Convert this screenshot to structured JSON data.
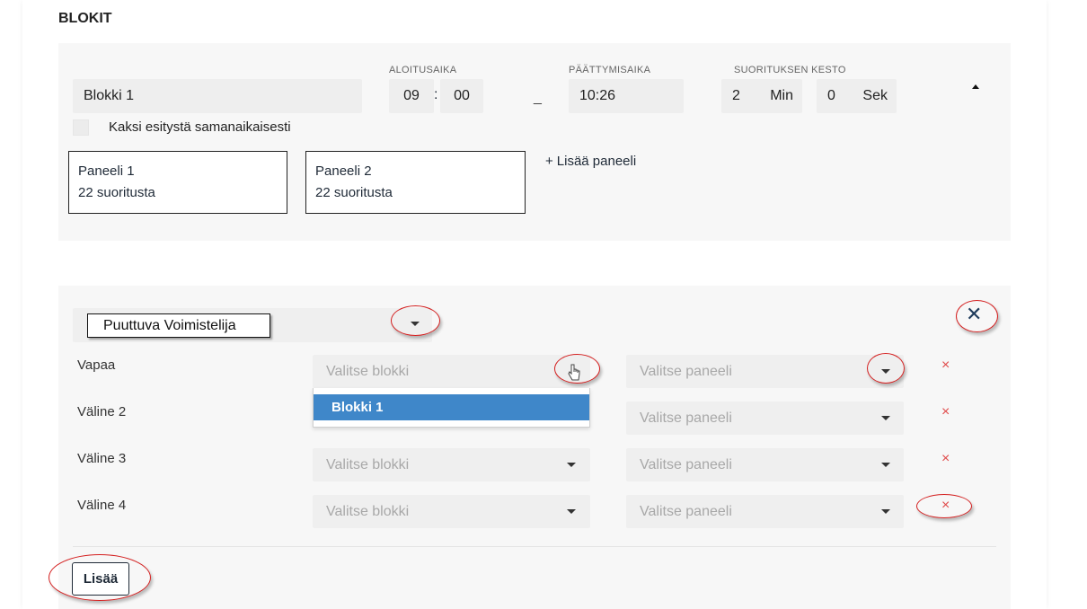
{
  "section": {
    "title": "BLOKIT"
  },
  "block": {
    "name_value": "Blokki 1",
    "start_label": "ALOITUSAIKA",
    "start_hour": "09",
    "time_colon": ":",
    "start_min": "00",
    "range_dash": "_",
    "end_label": "PÄÄTTYMISAIKA",
    "end_value": "10:26",
    "duration_label": "SUORITUKSEN KESTO",
    "duration_min": "2",
    "min_unit": "Min",
    "duration_sec": "0",
    "sec_unit": "Sek",
    "simultaneous_label": "Kaksi esitystä samanaikaisesti",
    "panels": [
      {
        "name": "Paneeli 1",
        "count": "22 suoritusta"
      },
      {
        "name": "Paneeli 2",
        "count": "22 suoritusta"
      }
    ],
    "add_panel_icon": "+",
    "add_panel_label": "Lisää paneeli"
  },
  "missing": {
    "type_select_value": "Puuttuva Voimistelija",
    "rows": [
      {
        "label": "Vapaa",
        "block_placeholder": "Valitse blokki",
        "panel_placeholder": "Valitse paneeli",
        "remove": "×"
      },
      {
        "label": "Väline 2",
        "block_placeholder": "Valitse blokki",
        "panel_placeholder": "Valitse paneeli",
        "remove": "×"
      },
      {
        "label": "Väline 3",
        "block_placeholder": "Valitse blokki",
        "panel_placeholder": "Valitse paneeli",
        "remove": "×"
      },
      {
        "label": "Väline 4",
        "block_placeholder": "Valitse blokki",
        "panel_placeholder": "Valitse paneeli",
        "remove": "×"
      }
    ],
    "dropdown_options": [
      "Blokki 1"
    ],
    "close_icon": "✕",
    "add_button": "Lisää"
  },
  "colors": {
    "accent_blue": "#3f87c9",
    "remove_red": "#e04a4a",
    "annotation_red": "#d42020"
  }
}
